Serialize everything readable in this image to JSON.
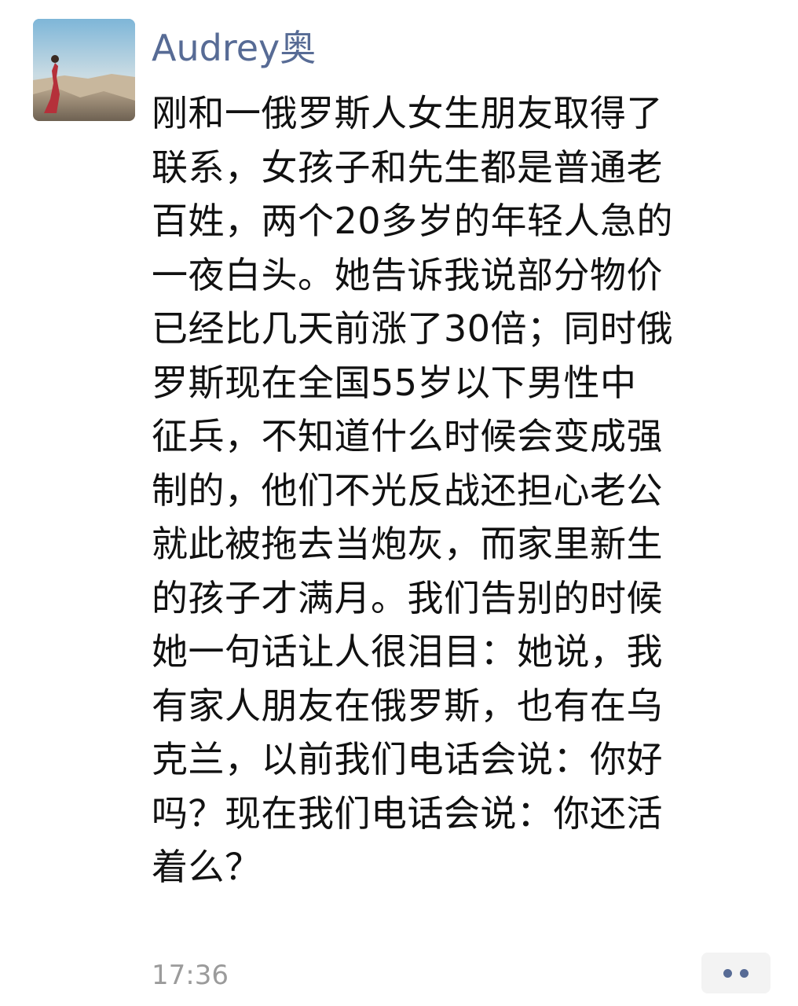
{
  "post": {
    "author": "Audrey奥",
    "avatar_icon": "profile-photo-woman-on-cliff",
    "content_lines": [
      "刚和一俄罗斯人女生朋友取得了",
      "联系，女孩子和先生都是普通老",
      "百姓，两个20多岁的年轻人急的",
      "一夜白头。她告诉我说部分物价",
      "已经比几天前涨了30倍；同时俄",
      "罗斯现在全国55岁以下男性中",
      "征兵，不知道什么时候会变成强",
      "制的，他们不光反战还担心老公",
      "就此被拖去当炮灰，而家里新生",
      "的孩子才满月。我们告别的时候",
      "她一句话让人很泪目：她说，我",
      "有家人朋友在俄罗斯，也有在乌",
      "克兰，以前我们电话会说：你好",
      "吗？现在我们电话会说：你还活",
      "着么？"
    ],
    "timestamp": "17:36",
    "more_icon": "more-dots-icon"
  },
  "colors": {
    "author_name": "#576b95",
    "body_text": "#111111",
    "timestamp": "#9b9b9b",
    "more_button_bg": "#f3f3f3"
  }
}
